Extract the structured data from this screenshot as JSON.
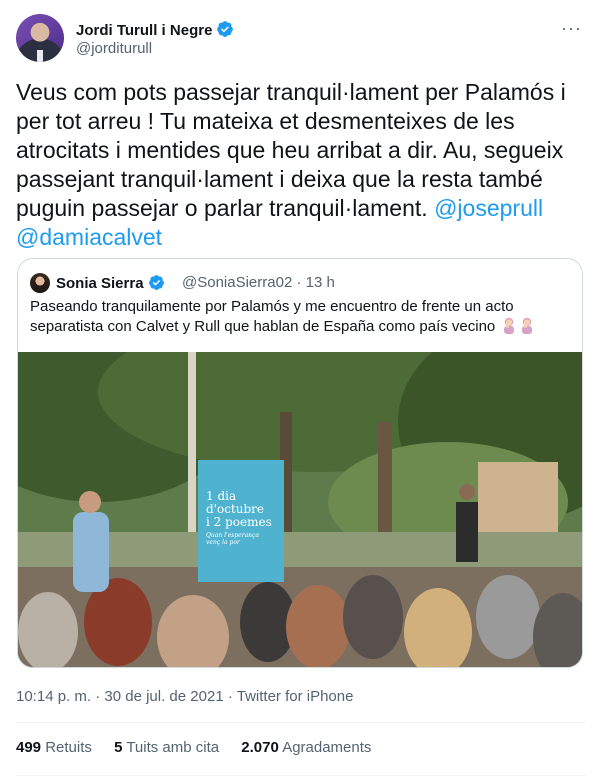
{
  "author": {
    "name": "Jordi Turull i Negre",
    "handle": "@jorditurull",
    "verified": true,
    "avatar": "avatar-icon"
  },
  "menu_icon": "more-horizontal-icon",
  "tweet": {
    "text_main": "Veus com pots passejar tranquil·lament per Palamós i per tot arreu ! Tu mateixa et desmenteixes de les atrocitats i mentides que heu arribat a dir. Au, segueix passejant tranquil·lament i deixa que la resta també puguin passejar o parlar tranquil·lament.",
    "mention1": "@joseprull",
    "mention2": "@damiacalvet"
  },
  "quote": {
    "name": "Sonia Sierra",
    "handle": "@SoniaSierra02 · 13 h",
    "verified": true,
    "text": "Paseando tranquilamente por Palamós y me encuentro de frente un acto separatista con Calvet y Rull que hablan de España como país vecino",
    "emojis": [
      "woman-facepalming-emoji",
      "woman-facepalming-emoji"
    ],
    "photo": {
      "banner_line1": "1 dia",
      "banner_line2": "d'octubre",
      "banner_line3": "i 2 poemes",
      "banner_sub1": "Quan l'esperança",
      "banner_sub2": "venç la por"
    }
  },
  "meta": {
    "time": "10:14 p. m.",
    "sep": " · ",
    "date": "30 de jul. de 2021",
    "via": "Twitter for iPhone"
  },
  "stats": {
    "retweets_count": "499",
    "retweets_label": "Retuits",
    "quotes_count": "5",
    "quotes_label": "Tuits amb cita",
    "likes_count": "2.070",
    "likes_label": "Agradaments"
  },
  "colors": {
    "accent": "#1d9bf0",
    "text": "#0f1419",
    "muted": "#536471",
    "border": "#cfd9de"
  }
}
